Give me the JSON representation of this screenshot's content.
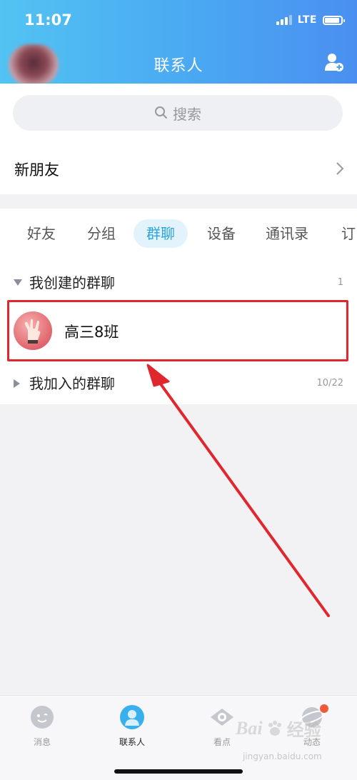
{
  "status_bar": {
    "time": "11:07",
    "network": "LTE"
  },
  "header": {
    "title": "联系人",
    "add_icon": "add-contact-icon"
  },
  "search": {
    "placeholder": "搜索",
    "icon": "search-icon"
  },
  "new_friends": {
    "label": "新朋友"
  },
  "tabs": [
    {
      "label": "好友",
      "active": false
    },
    {
      "label": "分组",
      "active": false
    },
    {
      "label": "群聊",
      "active": true
    },
    {
      "label": "设备",
      "active": false
    },
    {
      "label": "通讯录",
      "active": false
    },
    {
      "label": "订",
      "active": false
    }
  ],
  "sections": {
    "created": {
      "label": "我创建的群聊",
      "count": "1"
    },
    "joined": {
      "label": "我加入的群聊",
      "count": "10/22"
    }
  },
  "groups": [
    {
      "name": "高三8班"
    }
  ],
  "tabbar": {
    "items": [
      {
        "label": "消息",
        "icon": "message-icon",
        "active": false
      },
      {
        "label": "联系人",
        "icon": "contacts-icon",
        "active": true
      },
      {
        "label": "看点",
        "icon": "eye-icon",
        "active": false
      },
      {
        "label": "动态",
        "icon": "planet-icon",
        "active": false
      }
    ]
  },
  "watermark": {
    "brand": "Bai",
    "brand_cn": "经验",
    "url": "jingyan.baidu.com"
  },
  "colors": {
    "header_start": "#52c3f2",
    "header_end": "#4a8ff0",
    "active_tab_bg": "#e3f3fb",
    "active_tab_text": "#2aa3df",
    "annotation_red": "#e0272d"
  }
}
